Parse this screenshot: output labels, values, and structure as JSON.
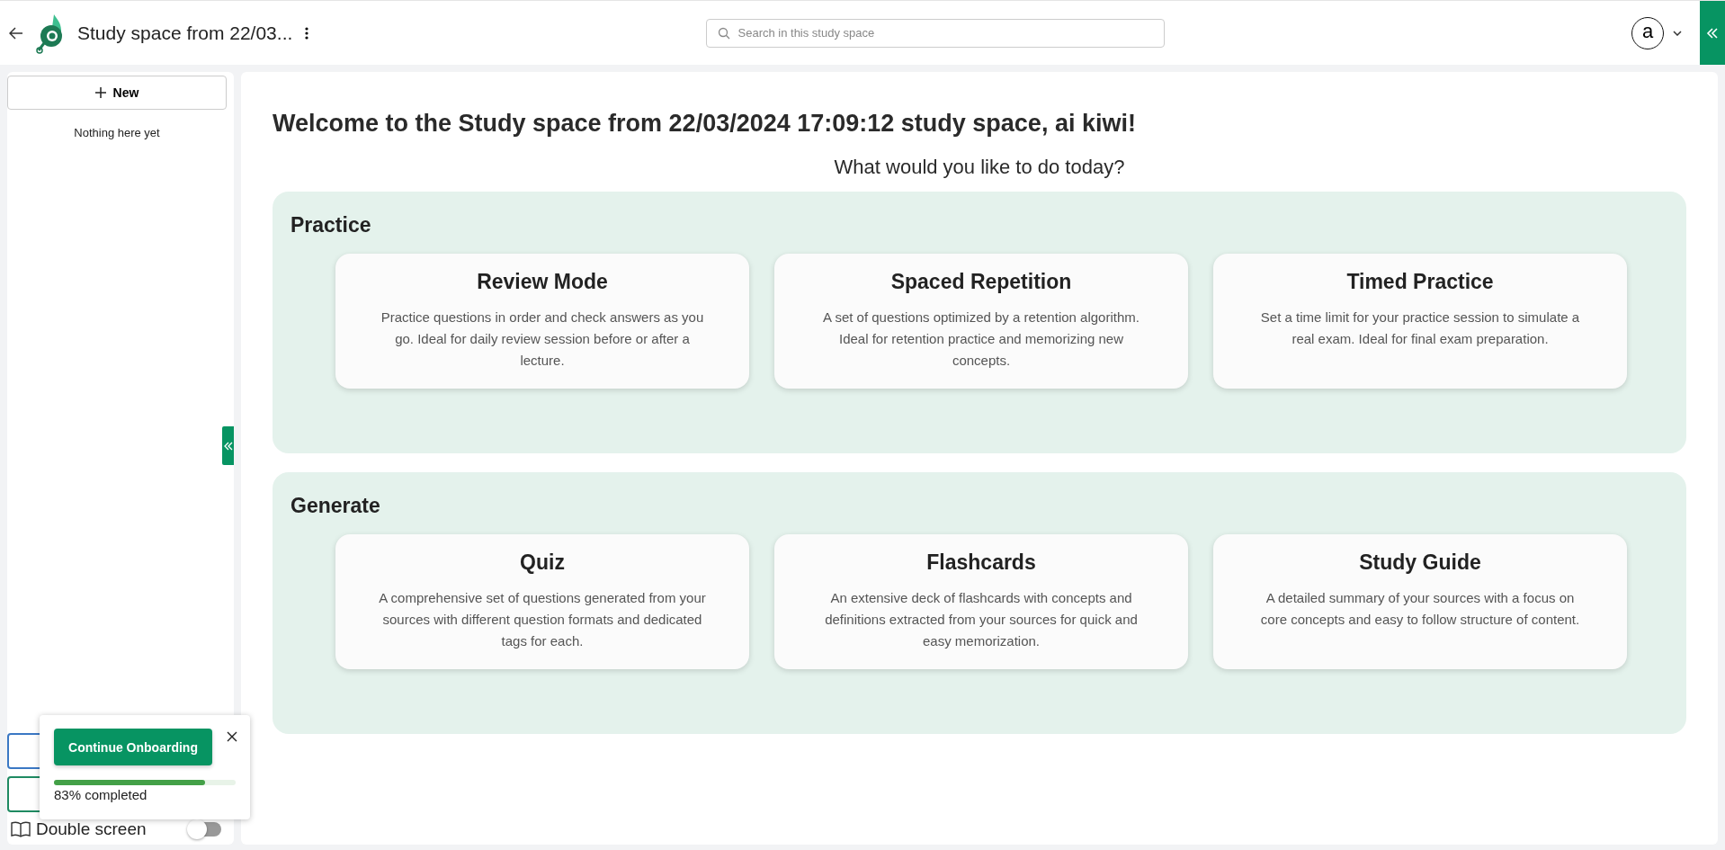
{
  "header": {
    "title": "Study space from 22/03...",
    "search": {
      "placeholder": "Search in this study space"
    },
    "avatar": "a"
  },
  "sidebar": {
    "new_button": "New",
    "empty_text": "Nothing here yet",
    "double_screen": {
      "label": "Double screen",
      "on": false
    }
  },
  "onboarding": {
    "button": "Continue Onboarding",
    "level": 0.83,
    "progress_text": "83% completed"
  },
  "main": {
    "heading": "Welcome to the Study space from 22/03/2024 17:09:12 study space, ai kiwi!",
    "subheading": "What would you like to do today?",
    "sections": [
      {
        "title": "Practice",
        "cards": [
          {
            "title": "Review Mode",
            "description": "Practice questions in order and check answers as you go. Ideal for daily review session before or after a lecture."
          },
          {
            "title": "Spaced Repetition",
            "description": "A set of questions optimized by a retention algorithm. Ideal for retention practice and memorizing new concepts."
          },
          {
            "title": "Timed Practice",
            "description": "Set a time limit for your practice session to simulate a real exam. Ideal for final exam preparation."
          }
        ]
      },
      {
        "title": "Generate",
        "cards": [
          {
            "title": "Quiz",
            "description": "A comprehensive set of questions generated from your sources with different question formats and dedicated tags for each."
          },
          {
            "title": "Flashcards",
            "description": "An extensive deck of flashcards with concepts and definitions extracted from your sources for quick and easy memorization."
          },
          {
            "title": "Study Guide",
            "description": "A detailed summary of your sources with a focus on core concepts and easy to follow structure of content."
          }
        ]
      }
    ]
  }
}
